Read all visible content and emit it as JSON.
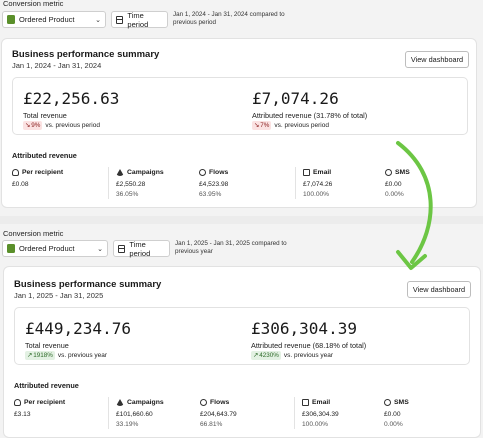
{
  "panels": [
    {
      "metric_label": "Conversion metric",
      "metric_select": "Ordered Product",
      "time_period_label": "Time period",
      "date_note": "Jan 1, 2024 - Jan 31, 2024 compared to previous period",
      "card_title": "Business performance summary",
      "card_subtitle": "Jan 1, 2024 - Jan 31, 2024",
      "view_dashboard": "View dashboard",
      "total_revenue_value": "£22,256.63",
      "total_revenue_label": "Total revenue",
      "total_change": "9%",
      "total_change_dir": "down",
      "total_change_note": "vs. previous period",
      "attributed_value": "£7,074.26",
      "attributed_label": "Attributed revenue (31.78% of total)",
      "attributed_change": "7%",
      "attributed_change_dir": "down",
      "attributed_change_note": "vs. previous period",
      "attr_section_title": "Attributed revenue",
      "columns": [
        {
          "label": "Per recipient",
          "icon": "people-icon",
          "value": "£0.08",
          "pct": ""
        },
        {
          "label": "Campaigns",
          "icon": "send-icon",
          "value": "£2,550.28",
          "pct": "36.05%"
        },
        {
          "label": "Flows",
          "icon": "flow-icon",
          "value": "£4,523.98",
          "pct": "63.95%"
        },
        {
          "label": "Email",
          "icon": "email-icon",
          "value": "£7,074.26",
          "pct": "100.00%"
        },
        {
          "label": "SMS",
          "icon": "sms-icon",
          "value": "£0.00",
          "pct": "0.00%"
        }
      ]
    },
    {
      "metric_label": "Conversion metric",
      "metric_select": "Ordered Product",
      "time_period_label": "Time period",
      "date_note": "Jan 1, 2025 - Jan 31, 2025 compared to previous year",
      "card_title": "Business performance summary",
      "card_subtitle": "Jan 1, 2025 - Jan 31, 2025",
      "view_dashboard": "View dashboard",
      "total_revenue_value": "£449,234.76",
      "total_revenue_label": "Total revenue",
      "total_change": "1918%",
      "total_change_dir": "up",
      "total_change_note": "vs. previous year",
      "attributed_value": "£306,304.39",
      "attributed_label": "Attributed revenue (68.18% of total)",
      "attributed_change": "4230%",
      "attributed_change_dir": "up",
      "attributed_change_note": "vs. previous year",
      "attr_section_title": "Attributed revenue",
      "columns": [
        {
          "label": "Per recipient",
          "icon": "people-icon",
          "value": "£3.13",
          "pct": ""
        },
        {
          "label": "Campaigns",
          "icon": "send-icon",
          "value": "£101,660.60",
          "pct": "33.19%"
        },
        {
          "label": "Flows",
          "icon": "flow-icon",
          "value": "£204,643.79",
          "pct": "66.81%"
        },
        {
          "label": "Email",
          "icon": "email-icon",
          "value": "£306,304.39",
          "pct": "100.00%"
        },
        {
          "label": "SMS",
          "icon": "sms-icon",
          "value": "£0.00",
          "pct": "0.00%"
        }
      ]
    }
  ],
  "arrow_color": "#6cc644"
}
